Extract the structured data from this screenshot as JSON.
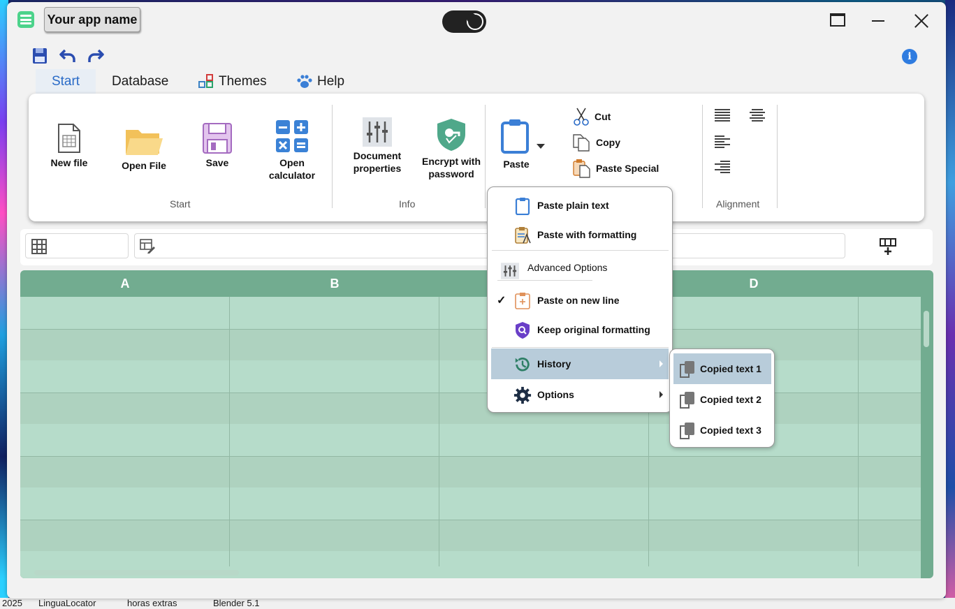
{
  "app": {
    "name": "Your app name"
  },
  "quick_access": {
    "items": [
      "save-icon",
      "undo-icon",
      "redo-icon"
    ]
  },
  "tabs": [
    {
      "label": "Start",
      "active": true
    },
    {
      "label": "Database",
      "active": false
    },
    {
      "label": "Themes",
      "active": false
    },
    {
      "label": "Help",
      "active": false
    }
  ],
  "ribbon": {
    "start_group": {
      "label": "Start",
      "buttons": [
        {
          "label": "New file",
          "icon": "new-file-icon"
        },
        {
          "label": "Open File",
          "icon": "folder-icon"
        },
        {
          "label": "Save",
          "icon": "save-icon"
        },
        {
          "label_line1": "Open",
          "label_line2": "calculator",
          "icon": "calculator-icon"
        }
      ]
    },
    "info_group": {
      "label": "Info",
      "buttons": [
        {
          "label_line1": "Document",
          "label_line2": "properties",
          "icon": "sliders-icon"
        },
        {
          "label_line1": "Encrypt with",
          "label_line2": "password",
          "icon": "shield-icon"
        }
      ]
    },
    "clipboard": {
      "paste": "Paste",
      "cut": "Cut",
      "copy": "Copy",
      "paste_special": "Paste Special"
    },
    "alignment_group": {
      "label": "Alignment"
    }
  },
  "sheet": {
    "columns": [
      "A",
      "B",
      "",
      "D",
      ""
    ]
  },
  "paste_menu": {
    "items": [
      {
        "label": "Paste plain text"
      },
      {
        "label": "Paste with formatting"
      },
      {
        "label": "Advanced Options"
      },
      {
        "label": "Paste on new line",
        "checked": true
      },
      {
        "label": "Keep original formatting"
      },
      {
        "label": "History",
        "highlighted": true,
        "has_submenu": true
      },
      {
        "label": "Options",
        "has_submenu": true
      }
    ],
    "check_mark": "✓"
  },
  "history_submenu": {
    "items": [
      {
        "label": "Copied text 1",
        "highlighted": true
      },
      {
        "label": "Copied text 2"
      },
      {
        "label": "Copied text 3"
      }
    ]
  },
  "taskbar": {
    "items": [
      "2025",
      "LinguaLocator",
      "horas extras",
      "Blender 5.1"
    ]
  },
  "colors": {
    "accent": "#2a6bc7",
    "sheet_header": "#72ac90",
    "sheet_row_light": "#b6dcca",
    "sheet_row_dark": "#aed2bf",
    "menu_highlight": "#b8ccda"
  }
}
